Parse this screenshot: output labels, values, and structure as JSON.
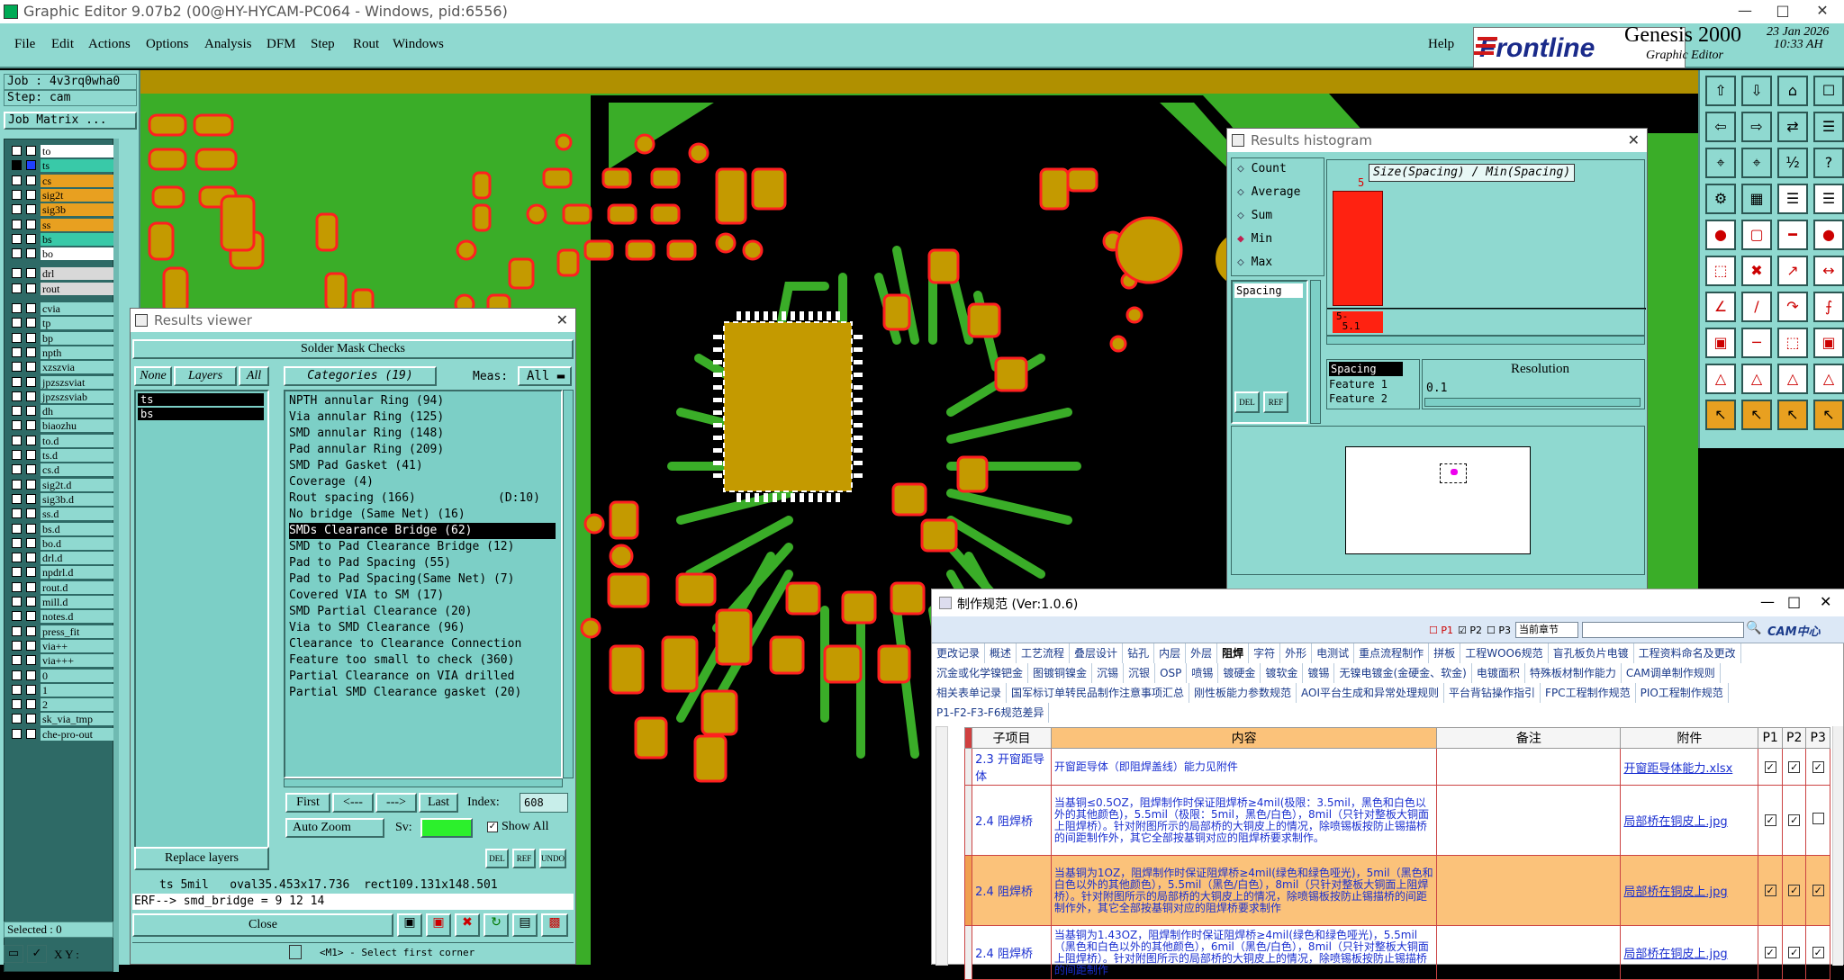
{
  "window": {
    "title": "Graphic Editor 9.07b2 (00@HY-HYCAM-PC064 - Windows, pid:6556)"
  },
  "menu": {
    "items": [
      "File",
      "Edit",
      "Actions",
      "Options",
      "Analysis",
      "DFM",
      "Step",
      "Rout",
      "Windows"
    ],
    "help": "Help"
  },
  "brand": {
    "logo": "Frontline",
    "product": "Genesis 2000",
    "subtitle": "Graphic Editor",
    "date": "23 Jan 2026",
    "time": "10:33 AH"
  },
  "job": {
    "job_line": "Job : 4v3rq0wha0",
    "step_line": "Step: cam",
    "matrix_button": "Job Matrix ..."
  },
  "layers": [
    {
      "name": "to",
      "color": "#ffffff"
    },
    {
      "name": "ts",
      "color": "#39c9a8",
      "active": true
    },
    {
      "name": "cs",
      "color": "#e8a020"
    },
    {
      "name": "sig2t",
      "color": "#e8a020"
    },
    {
      "name": "sig3b",
      "color": "#e8a020"
    },
    {
      "name": "ss",
      "color": "#e8a020"
    },
    {
      "name": "bs",
      "color": "#39c9a8"
    },
    {
      "name": "bo",
      "color": "#ffffff"
    },
    {
      "name": "drl",
      "color": "#d8d8d8"
    },
    {
      "name": "rout",
      "color": "#d8d8d8"
    },
    {
      "name": "cvia"
    },
    {
      "name": "tp"
    },
    {
      "name": "bp"
    },
    {
      "name": "npth"
    },
    {
      "name": "xzszvia"
    },
    {
      "name": "jpzszsviat"
    },
    {
      "name": "jpzszsviab"
    },
    {
      "name": "dh"
    },
    {
      "name": "biaozhu"
    },
    {
      "name": "to.d"
    },
    {
      "name": "ts.d"
    },
    {
      "name": "cs.d"
    },
    {
      "name": "sig2t.d"
    },
    {
      "name": "sig3b.d"
    },
    {
      "name": "ss.d"
    },
    {
      "name": "bs.d"
    },
    {
      "name": "bo.d"
    },
    {
      "name": "drl.d"
    },
    {
      "name": "npdrl.d"
    },
    {
      "name": "rout.d"
    },
    {
      "name": "mill.d"
    },
    {
      "name": "notes.d"
    },
    {
      "name": "press_fit"
    },
    {
      "name": "via++"
    },
    {
      "name": "via+++"
    },
    {
      "name": "0"
    },
    {
      "name": "1"
    },
    {
      "name": "2"
    },
    {
      "name": "sk_via_tmp"
    },
    {
      "name": "che-pro-out"
    }
  ],
  "status": {
    "selected": "Selected : 0",
    "xy_label": "X Y :",
    "hint": "<M1> - Select first corner"
  },
  "results_viewer": {
    "title": "Results viewer",
    "header": "Solder Mask Checks",
    "left_tabs": [
      "None",
      "Layers",
      "All"
    ],
    "layer_list": [
      "ts",
      "bs"
    ],
    "categories_label": "Categories (19)",
    "meas_label": "Meas:",
    "meas_value": "All",
    "categories": [
      "NPTH annular Ring (94)",
      "Via annular Ring (125)",
      "SMD annular Ring (148)",
      "Pad annular Ring (209)",
      "SMD Pad Gasket (41)",
      "Coverage (4)",
      "Rout spacing (166)",
      "No bridge (Same Net) (16)",
      "SMDs Clearance Bridge (62)",
      "SMD to Pad Clearance Bridge (12)",
      "Pad to Pad Spacing (55)",
      "Pad to Pad Spacing(Same Net) (7)",
      "Covered VIA to SM (17)",
      "SMD Partial Clearance (20)",
      "Via to SMD Clearance (96)",
      "Clearance to Clearance Connection",
      "Feature too small to check (360)",
      "Partial Clearance on VIA drilled",
      "Partial SMD Clearance gasket (20)"
    ],
    "rout_suffix": "(D:10)",
    "selected_index": 8,
    "nav": [
      "First",
      "<---",
      "--->",
      "Last"
    ],
    "index_label": "Index:",
    "index_value": "608",
    "auto_zoom": "Auto Zoom",
    "sv_label": "Sv:",
    "show_all": "Show All",
    "replace_layers": "Replace layers",
    "info_line": "ts 5mil   oval35.453x17.736  rect109.131x148.501",
    "erf_line": "ERF--> smd_bridge = 9 12 14",
    "close": "Close"
  },
  "histogram": {
    "title": "Results histogram",
    "options": [
      "Count",
      "Average",
      "Sum",
      "Min",
      "Max"
    ],
    "selected_option": "Min",
    "list_item": "Spacing",
    "chart_title": "Size(Spacing) / Min(Spacing)",
    "bar_value": "5",
    "bar_label": "5-\n 5.1",
    "fields": [
      "Spacing",
      "Feature 1",
      "Feature 2"
    ],
    "resolution_label": "Resolution",
    "resolution_value": "0.1",
    "del": "DEL",
    "ref": "REF"
  },
  "spec": {
    "title": "制作规范 (Ver:1.0.6)",
    "filters": [
      "P1",
      "P2",
      "P3"
    ],
    "scope": "当前章节",
    "cam_logo": "CAM中心",
    "tabs_row1": [
      "更改记录",
      "概述",
      "工艺流程",
      "叠层设计",
      "钻孔",
      "内层",
      "外层",
      "阻焊",
      "字符",
      "外形",
      "电测试",
      "重点流程制作",
      "拼板",
      "工程WOO6规范",
      "盲孔板负片电镀",
      "工程资料命名及更改"
    ],
    "tabs_row2": [
      "沉金或化学镍钯金",
      "图镀铜镍金",
      "沉锡",
      "沉银",
      "OSP",
      "喷锡",
      "镀硬金",
      "镀软金",
      "镀锡",
      "无镍电镀金(金硬金、软金)",
      "电镀面积",
      "特殊板材制作能力",
      "CAM调单制作规则"
    ],
    "tabs_row3": [
      "相关表单记录",
      "国军标订单转民品制作注意事项汇总",
      "刚性板能力参数规范",
      "AOI平台生成和异常处理规则",
      "平台背钻操作指引",
      "FPC工程制作规范",
      "PIO工程制作规范"
    ],
    "tabs_row4": [
      "P1-F2-F3-F6规范差异"
    ],
    "active_tab": "阻焊",
    "columns": [
      "子项目",
      "内容",
      "备注",
      "附件",
      "P1",
      "P2",
      "P3"
    ],
    "rows": [
      {
        "sub": "2.3 开窗距导体",
        "content": "开窗距导体（即阻焊盖线）能力见附件",
        "note": "",
        "attach": "开窗距导体能力.xlsx",
        "p": [
          true,
          true,
          true
        ]
      },
      {
        "sub": "2.4 阻焊桥",
        "content": "当基铜≤0.5OZ，阻焊制作时保证阻焊桥≥4mil(极限：3.5mil，黑色和白色以外的其他颜色)，5.5mil（极限：5mil，黑色/白色），8mil（只针对整板大铜面上阻焊桥）。针对附图所示的局部桥的大铜皮上的情况，除喷锡板按防止锡描桥的间距制作外，其它全部按基铜对应的阻焊桥要求制作。",
        "note": "",
        "attach": "局部桥在铜皮上.jpg",
        "p": [
          true,
          true,
          false
        ]
      },
      {
        "sub": "2.4 阻焊桥",
        "content": "当基铜为1OZ，阻焊制作时保证阻焊桥≥4mil(绿色和绿色哑光)，5mil（黑色和白色以外的其他颜色），5.5mil（黑色/白色），8mil（只针对整板大铜面上阻焊桥）。针对附图所示的局部桥的大铜皮上的情况，除喷锡板按防止锡描桥的间距制作外，其它全部按基铜对应的阻焊桥要求制作",
        "note": "",
        "attach": "局部桥在铜皮上.jpg",
        "p": [
          true,
          true,
          true
        ],
        "highlight": true
      },
      {
        "sub": "2.4 阻焊桥",
        "content": "当基铜为1.43OZ，阻焊制作时保证阻焊桥≥4mil(绿色和绿色哑光)，5.5mil（黑色和白色以外的其他颜色），6mil（黑色/白色），8mil（只针对整板大铜面上阻焊桥）。针对附图所示的局部桥的大铜皮上的情况，除喷锡板按防止锡描桥的间距制作",
        "note": "",
        "attach": "局部桥在铜皮上.jpg",
        "p": [
          true,
          true,
          true
        ]
      }
    ]
  },
  "colors": {
    "teal_bg": "#8fd9d0",
    "pcb_green": "#3aad28",
    "pad_gold": "#c49a00",
    "outline_red": "#ff2020",
    "board_tan": "#b09000"
  }
}
